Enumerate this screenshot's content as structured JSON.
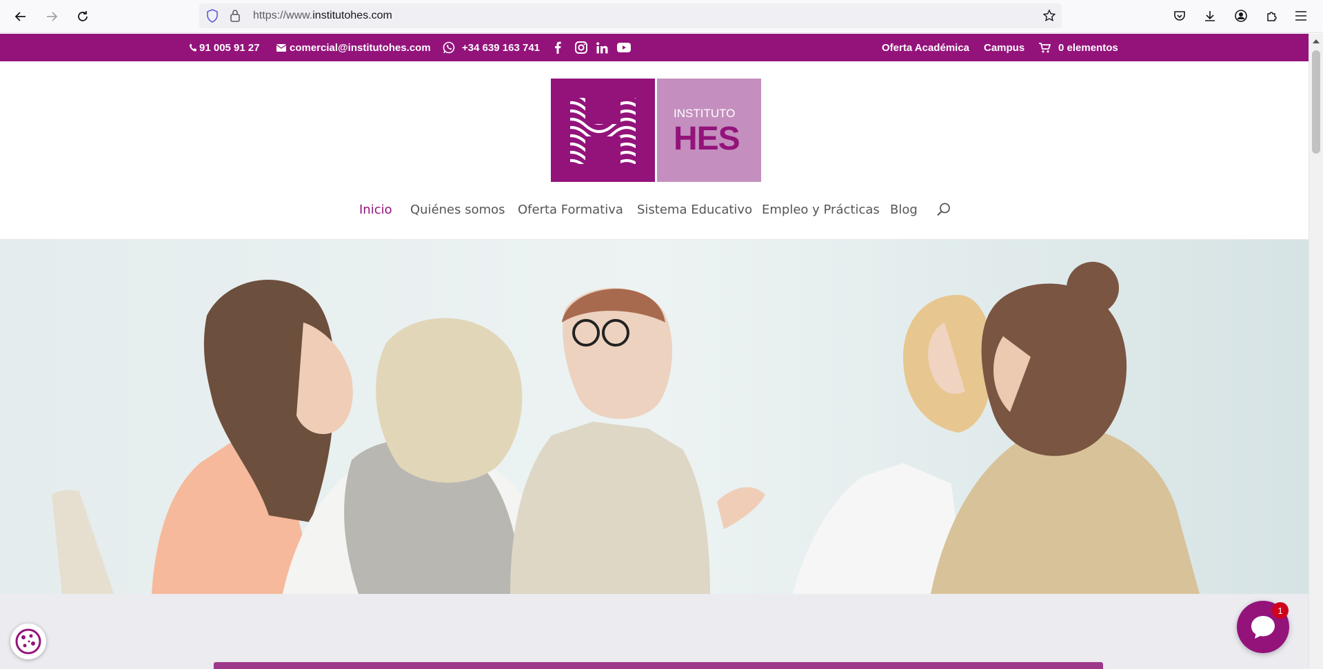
{
  "browser": {
    "url_prefix": "https://www.",
    "url_domain": "institutohes.com",
    "icons": {
      "back": "back-arrow-icon",
      "forward": "forward-arrow-icon",
      "reload": "reload-icon",
      "shield": "tracking-protection-shield-icon",
      "lock": "lock-icon",
      "bookmark": "star-icon",
      "pocket": "pocket-icon",
      "downloads": "download-icon",
      "account": "account-icon",
      "extensions": "extensions-puzzle-icon",
      "menu": "hamburger-menu-icon"
    }
  },
  "topbar": {
    "phone": "91 005 91 27",
    "email": "comercial@institutohes.com",
    "whatsapp": "+34 639 163 741",
    "social": [
      "facebook-icon",
      "instagram-icon",
      "linkedin-icon",
      "youtube-icon"
    ],
    "links": {
      "oferta": "Oferta Académica",
      "campus": "Campus",
      "cart": "0 elementos"
    },
    "bg_color": "#93137b"
  },
  "logo": {
    "line1": "INSTITUTO",
    "line2": "HES",
    "colors": {
      "primary": "#93137b",
      "secondary": "#c48fbe"
    }
  },
  "nav": {
    "items": [
      {
        "label": "Inicio",
        "active": true
      },
      {
        "label": "Quiénes somos",
        "active": false
      },
      {
        "label": "Oferta Formativa",
        "active": false
      },
      {
        "label": "Sistema Educativo",
        "active": false
      },
      {
        "label": "Empleo y Prácticas",
        "active": false
      },
      {
        "label": "Blog",
        "active": false
      }
    ],
    "search_icon": "search-icon"
  },
  "hero": {
    "image": "group-therapy-session-photo"
  },
  "chat": {
    "unread": "1",
    "icon": "chat-bubble-icon"
  },
  "cookie": {
    "icon": "cookie-icon"
  }
}
